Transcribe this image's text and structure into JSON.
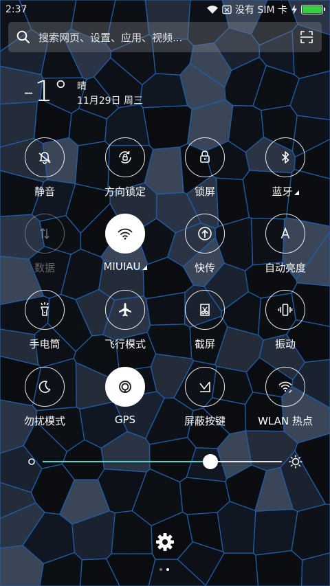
{
  "status_bar": {
    "time": "2:37",
    "no_sim": "没有 SIM 卡",
    "battery_color": "#35d13b"
  },
  "search": {
    "placeholder": "搜索网页、设置、应用、视频..."
  },
  "weather": {
    "temperature": "-1°",
    "condition": "晴",
    "date": "11月29日 周三"
  },
  "toggles": [
    {
      "label": "静音",
      "icon": "bell-off-icon"
    },
    {
      "label": "方向锁定",
      "icon": "rotation-lock-icon"
    },
    {
      "label": "锁屏",
      "icon": "lock-icon"
    },
    {
      "label": "蓝牙",
      "icon": "bluetooth-icon",
      "more": true
    },
    {
      "label": "数据",
      "icon": "mobile-data-icon",
      "disabled": true
    },
    {
      "label": "MIUIAU",
      "icon": "wifi-icon",
      "active": true,
      "more": true
    },
    {
      "label": "快传",
      "icon": "transfer-icon"
    },
    {
      "label": "自动亮度",
      "icon": "auto-brightness-icon"
    },
    {
      "label": "手电筒",
      "icon": "flashlight-icon"
    },
    {
      "label": "飞行模式",
      "icon": "airplane-icon"
    },
    {
      "label": "截屏",
      "icon": "screenshot-icon"
    },
    {
      "label": "振动",
      "icon": "vibrate-icon"
    },
    {
      "label": "勿扰模式",
      "icon": "moon-icon"
    },
    {
      "label": "GPS",
      "icon": "gps-icon",
      "active": true
    },
    {
      "label": "屏蔽按键",
      "icon": "block-keys-icon"
    },
    {
      "label": "WLAN 热点",
      "icon": "hotspot-icon"
    }
  ],
  "brightness": {
    "level": 0.7,
    "accent": "#55d6c9"
  },
  "pager": {
    "pages": 2,
    "current": 2
  }
}
